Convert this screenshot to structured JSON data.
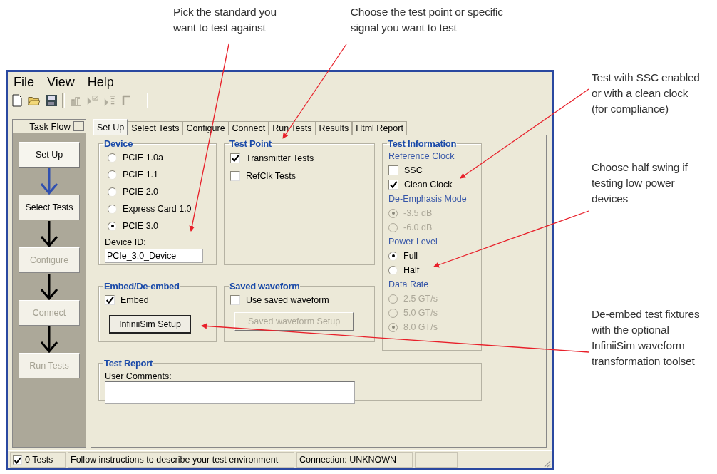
{
  "callouts_top": [
    {
      "lines": [
        "Pick the standard you",
        "want to test against"
      ]
    },
    {
      "lines": [
        "Choose the test point or specific",
        "signal you want to test"
      ]
    }
  ],
  "callouts_right": [
    {
      "lines": [
        "Test with SSC enabled",
        "or with a clean clock",
        "(for compliance)"
      ]
    },
    {
      "lines": [
        "Choose half swing if",
        "testing low power",
        "devices"
      ]
    },
    {
      "lines": [
        "De-embed test fixtures",
        "with the optional",
        "InfiniiSim waveform",
        "transformation toolset"
      ]
    }
  ],
  "menu": [
    "File",
    "View",
    "Help"
  ],
  "task_flow": {
    "title": "Task Flow",
    "minimize": "_",
    "steps": [
      {
        "label": "Set Up",
        "selected": true,
        "disabled": false
      },
      {
        "label": "Select Tests",
        "selected": false,
        "disabled": false
      },
      {
        "label": "Configure",
        "selected": false,
        "disabled": true
      },
      {
        "label": "Connect",
        "selected": false,
        "disabled": true
      },
      {
        "label": "Run Tests",
        "selected": false,
        "disabled": true
      }
    ]
  },
  "tabs": [
    {
      "label": "Set Up",
      "selected": true
    },
    {
      "label": "Select Tests",
      "selected": false
    },
    {
      "label": "Configure",
      "selected": false
    },
    {
      "label": "Connect",
      "selected": false
    },
    {
      "label": "Run Tests",
      "selected": false
    },
    {
      "label": "Results",
      "selected": false
    },
    {
      "label": "Html Report",
      "selected": false
    }
  ],
  "device": {
    "title": "Device",
    "options": [
      {
        "label": "PCIE 1.0a",
        "selected": false
      },
      {
        "label": "PCIE 1.1",
        "selected": false
      },
      {
        "label": "PCIE 2.0",
        "selected": false
      },
      {
        "label": "Express Card 1.0",
        "selected": false
      },
      {
        "label": "PCIE 3.0",
        "selected": true
      }
    ],
    "id_label": "Device ID:",
    "id_value": "PCIe_3.0_Device"
  },
  "test_point": {
    "title": "Test Point",
    "options": [
      {
        "label": "Transmitter Tests",
        "checked": true
      },
      {
        "label": "RefClk Tests",
        "checked": false
      }
    ]
  },
  "test_information": {
    "title": "Test Information",
    "sections": [
      {
        "heading": "Reference Clock",
        "kind": "checkbox",
        "disabled": false,
        "options": [
          {
            "label": "SSC",
            "checked": false
          },
          {
            "label": "Clean Clock",
            "checked": true
          }
        ]
      },
      {
        "heading": "De-Emphasis Mode",
        "kind": "radio",
        "disabled": true,
        "options": [
          {
            "label": "-3.5 dB",
            "selected": true
          },
          {
            "label": "-6.0 dB",
            "selected": false
          }
        ]
      },
      {
        "heading": "Power Level",
        "kind": "radio",
        "disabled": false,
        "options": [
          {
            "label": "Full",
            "selected": true
          },
          {
            "label": "Half",
            "selected": false
          }
        ]
      },
      {
        "heading": "Data Rate",
        "kind": "radio",
        "disabled": true,
        "options": [
          {
            "label": "2.5 GT/s",
            "selected": false
          },
          {
            "label": "5.0 GT/s",
            "selected": false
          },
          {
            "label": "8.0 GT/s",
            "selected": true
          }
        ]
      }
    ]
  },
  "embed": {
    "title": "Embed/De-embed",
    "option": {
      "label": "Embed",
      "checked": true
    },
    "button": {
      "label": "InfiniiSim Setup",
      "disabled": false
    }
  },
  "saved_waveform": {
    "title": "Saved waveform",
    "option": {
      "label": "Use saved waveform",
      "checked": false
    },
    "button": {
      "label": "Saved waveform Setup",
      "disabled": true
    }
  },
  "test_report": {
    "title": "Test Report",
    "comments_label": "User Comments:"
  },
  "status_bar": {
    "tests_checked": true,
    "tests": "0 Tests",
    "message": "Follow instructions to describe your test environment",
    "connection": "Connection: UNKNOWN"
  }
}
